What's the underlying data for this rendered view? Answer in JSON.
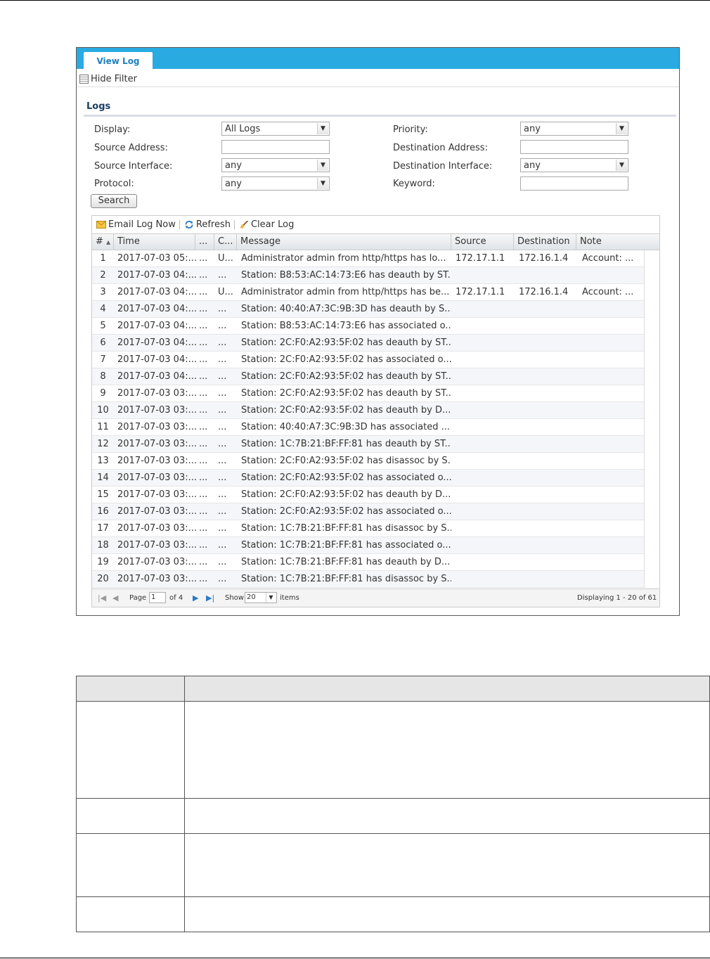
{
  "tab": {
    "label": "View Log"
  },
  "filter_toggle": {
    "label": "Hide Filter"
  },
  "section": {
    "title": "Logs"
  },
  "filters": {
    "display": {
      "label": "Display:",
      "value": "All Logs"
    },
    "priority": {
      "label": "Priority:",
      "value": "any"
    },
    "source_address": {
      "label": "Source Address:",
      "value": ""
    },
    "destination_address": {
      "label": "Destination Address:",
      "value": ""
    },
    "source_interface": {
      "label": "Source Interface:",
      "value": "any"
    },
    "destination_interface": {
      "label": "Destination Interface:",
      "value": "any"
    },
    "protocol": {
      "label": "Protocol:",
      "value": "any"
    },
    "keyword": {
      "label": "Keyword:",
      "value": ""
    },
    "search_label": "Search"
  },
  "toolbar": {
    "email": "Email Log Now",
    "refresh": "Refresh",
    "clear": "Clear Log"
  },
  "columns": {
    "num": "#",
    "time": "Time",
    "priority": "...",
    "category": "C...",
    "message": "Message",
    "source": "Source",
    "destination": "Destination",
    "note": "Note"
  },
  "rows": [
    {
      "n": "1",
      "time": "2017-07-03 05:...",
      "p": "...",
      "c": "U...",
      "msg": "Administrator admin from http/https has lo...",
      "src": "172.17.1.1",
      "dst": "172.16.1.4",
      "note": "Account: ..."
    },
    {
      "n": "2",
      "time": "2017-07-03 04:...",
      "p": "...",
      "c": "...",
      "msg": "Station: B8:53:AC:14:73:E6 has deauth by ST...",
      "src": "",
      "dst": "",
      "note": ""
    },
    {
      "n": "3",
      "time": "2017-07-03 04:...",
      "p": "...",
      "c": "U...",
      "msg": "Administrator admin from http/https has be...",
      "src": "172.17.1.1",
      "dst": "172.16.1.4",
      "note": "Account: ..."
    },
    {
      "n": "4",
      "time": "2017-07-03 04:...",
      "p": "...",
      "c": "...",
      "msg": "Station: 40:40:A7:3C:9B:3D has deauth by S...",
      "src": "",
      "dst": "",
      "note": ""
    },
    {
      "n": "5",
      "time": "2017-07-03 04:...",
      "p": "...",
      "c": "...",
      "msg": "Station: B8:53:AC:14:73:E6 has associated o...",
      "src": "",
      "dst": "",
      "note": ""
    },
    {
      "n": "6",
      "time": "2017-07-03 04:...",
      "p": "...",
      "c": "...",
      "msg": "Station: 2C:F0:A2:93:5F:02 has deauth by ST...",
      "src": "",
      "dst": "",
      "note": ""
    },
    {
      "n": "7",
      "time": "2017-07-03 04:...",
      "p": "...",
      "c": "...",
      "msg": "Station: 2C:F0:A2:93:5F:02 has associated o...",
      "src": "",
      "dst": "",
      "note": ""
    },
    {
      "n": "8",
      "time": "2017-07-03 04:...",
      "p": "...",
      "c": "...",
      "msg": "Station: 2C:F0:A2:93:5F:02 has deauth by ST...",
      "src": "",
      "dst": "",
      "note": ""
    },
    {
      "n": "9",
      "time": "2017-07-03 03:...",
      "p": "...",
      "c": "...",
      "msg": "Station: 2C:F0:A2:93:5F:02 has deauth by ST...",
      "src": "",
      "dst": "",
      "note": ""
    },
    {
      "n": "10",
      "time": "2017-07-03 03:...",
      "p": "...",
      "c": "...",
      "msg": "Station: 2C:F0:A2:93:5F:02 has deauth by D...",
      "src": "",
      "dst": "",
      "note": ""
    },
    {
      "n": "11",
      "time": "2017-07-03 03:...",
      "p": "...",
      "c": "...",
      "msg": "Station: 40:40:A7:3C:9B:3D has associated ...",
      "src": "",
      "dst": "",
      "note": ""
    },
    {
      "n": "12",
      "time": "2017-07-03 03:...",
      "p": "...",
      "c": "...",
      "msg": "Station: 1C:7B:21:BF:FF:81 has deauth by ST...",
      "src": "",
      "dst": "",
      "note": ""
    },
    {
      "n": "13",
      "time": "2017-07-03 03:...",
      "p": "...",
      "c": "...",
      "msg": "Station: 2C:F0:A2:93:5F:02 has disassoc by S...",
      "src": "",
      "dst": "",
      "note": ""
    },
    {
      "n": "14",
      "time": "2017-07-03 03:...",
      "p": "...",
      "c": "...",
      "msg": "Station: 2C:F0:A2:93:5F:02 has associated o...",
      "src": "",
      "dst": "",
      "note": ""
    },
    {
      "n": "15",
      "time": "2017-07-03 03:...",
      "p": "...",
      "c": "...",
      "msg": "Station: 2C:F0:A2:93:5F:02 has deauth by D...",
      "src": "",
      "dst": "",
      "note": ""
    },
    {
      "n": "16",
      "time": "2017-07-03 03:...",
      "p": "...",
      "c": "...",
      "msg": "Station: 2C:F0:A2:93:5F:02 has associated o...",
      "src": "",
      "dst": "",
      "note": ""
    },
    {
      "n": "17",
      "time": "2017-07-03 03:...",
      "p": "...",
      "c": "...",
      "msg": "Station: 1C:7B:21:BF:FF:81 has disassoc by S...",
      "src": "",
      "dst": "",
      "note": ""
    },
    {
      "n": "18",
      "time": "2017-07-03 03:...",
      "p": "...",
      "c": "...",
      "msg": "Station: 1C:7B:21:BF:FF:81 has associated o...",
      "src": "",
      "dst": "",
      "note": ""
    },
    {
      "n": "19",
      "time": "2017-07-03 03:...",
      "p": "...",
      "c": "...",
      "msg": "Station: 1C:7B:21:BF:FF:81 has deauth by D...",
      "src": "",
      "dst": "",
      "note": ""
    },
    {
      "n": "20",
      "time": "2017-07-03 03:...",
      "p": "...",
      "c": "...",
      "msg": "Station: 1C:7B:21:BF:FF:81 has disassoc by S...",
      "src": "",
      "dst": "",
      "note": ""
    }
  ],
  "pager": {
    "page_label": "Page",
    "page_value": "1",
    "of_label": "of 4",
    "show_label": "Show",
    "show_value": "20",
    "items_label": "items",
    "displaying": "Displaying 1 - 20 of 61"
  },
  "colors": {
    "tab_bar": "#29abe2",
    "tab_text": "#1f7fc0",
    "section_title": "#1b3e63"
  }
}
